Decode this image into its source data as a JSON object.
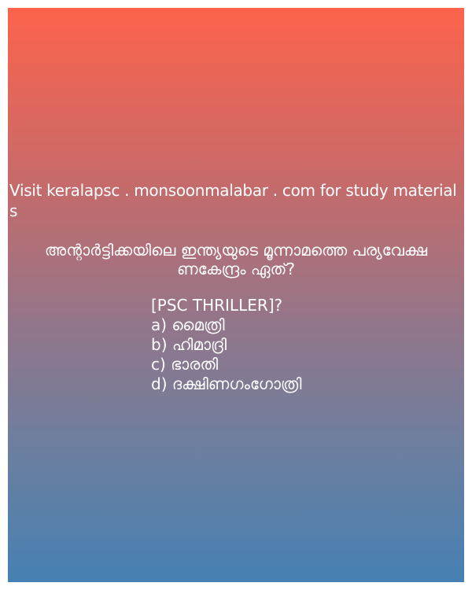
{
  "visit_text": "Visit keralapsc . monsoonmalabar . com for study materials",
  "question": {
    "line1": "അന്റാർട്ടിക്കയിലെ ഇന്ത്യയുടെ മൂന്നാമത്തെ പര്യവേക്ഷ",
    "line2": "ണകേന്ദ്രം ഏത്?"
  },
  "tag": "[PSC THRILLER]?",
  "options": [
    {
      "letter": "a)",
      "text": "മൈത്രി"
    },
    {
      "letter": "b)",
      "text": "ഹിമാദ്രി"
    },
    {
      "letter": "c)",
      "text": "ഭാരതി"
    },
    {
      "letter": "d)",
      "text": "ദക്ഷിണഗംഗോത്രി"
    }
  ],
  "colors": {
    "gradient_top": "#fd634c",
    "gradient_bottom": "#4680b3",
    "text": "#ffffff"
  }
}
